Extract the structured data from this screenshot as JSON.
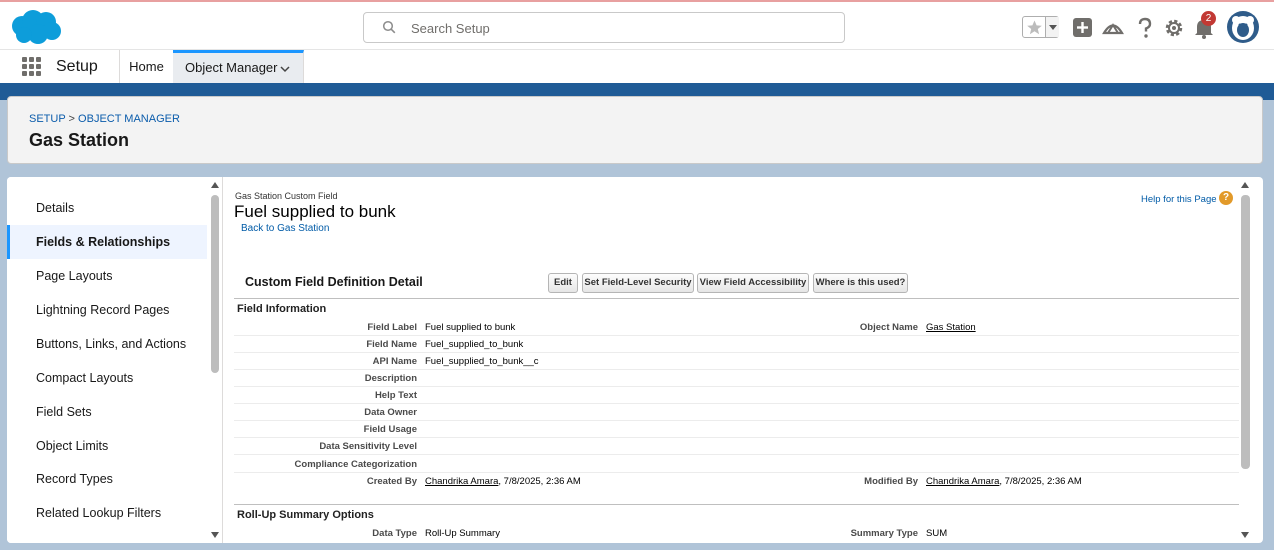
{
  "header": {
    "search_placeholder": "Search Setup",
    "notification_count": "2"
  },
  "nav": {
    "app_name": "Setup",
    "tabs": [
      {
        "label": "Home"
      },
      {
        "label": "Object Manager"
      }
    ]
  },
  "page_header": {
    "breadcrumb_setup": "SETUP",
    "breadcrumb_sep": ">",
    "breadcrumb_object_manager": "OBJECT MANAGER",
    "title": "Gas Station"
  },
  "sidebar": {
    "items": [
      {
        "label": "Details"
      },
      {
        "label": "Fields & Relationships"
      },
      {
        "label": "Page Layouts"
      },
      {
        "label": "Lightning Record Pages"
      },
      {
        "label": "Buttons, Links, and Actions"
      },
      {
        "label": "Compact Layouts"
      },
      {
        "label": "Field Sets"
      },
      {
        "label": "Object Limits"
      },
      {
        "label": "Record Types"
      },
      {
        "label": "Related Lookup Filters"
      }
    ]
  },
  "detail": {
    "type_label": "Gas Station Custom Field",
    "title": "Fuel supplied to bunk",
    "back_link": "Back to Gas Station",
    "help_link": "Help for this Page",
    "section_title": "Custom Field Definition Detail",
    "buttons": {
      "edit": "Edit",
      "field_level_security": "Set Field-Level Security",
      "field_accessibility": "View Field Accessibility",
      "where_used": "Where is this used?"
    },
    "field_info_heading": "Field Information",
    "rows": [
      {
        "label": "Field Label",
        "value": "Fuel supplied to bunk",
        "label2": "Object Name",
        "value2": "Gas Station"
      },
      {
        "label": "Field Name",
        "value": "Fuel_supplied_to_bunk"
      },
      {
        "label": "API Name",
        "value": "Fuel_supplied_to_bunk__c"
      },
      {
        "label": "Description",
        "value": ""
      },
      {
        "label": "Help Text",
        "value": ""
      },
      {
        "label": "Data Owner",
        "value": ""
      },
      {
        "label": "Field Usage",
        "value": ""
      },
      {
        "label": "Data Sensitivity Level",
        "value": ""
      },
      {
        "label": "Compliance Categorization",
        "value": ""
      },
      {
        "label": "Created By",
        "value_user": "Chandrika Amara",
        "value_date": ", 7/8/2025, 2:36 AM",
        "label2": "Modified By",
        "value2_user": "Chandrika Amara",
        "value2_date": ", 7/8/2025, 2:36 AM"
      }
    ],
    "rollup_heading": "Roll-Up Summary Options",
    "rollup_row": {
      "label": "Data Type",
      "value": "Roll-Up Summary",
      "label2": "Summary Type",
      "value2": "SUM"
    }
  }
}
